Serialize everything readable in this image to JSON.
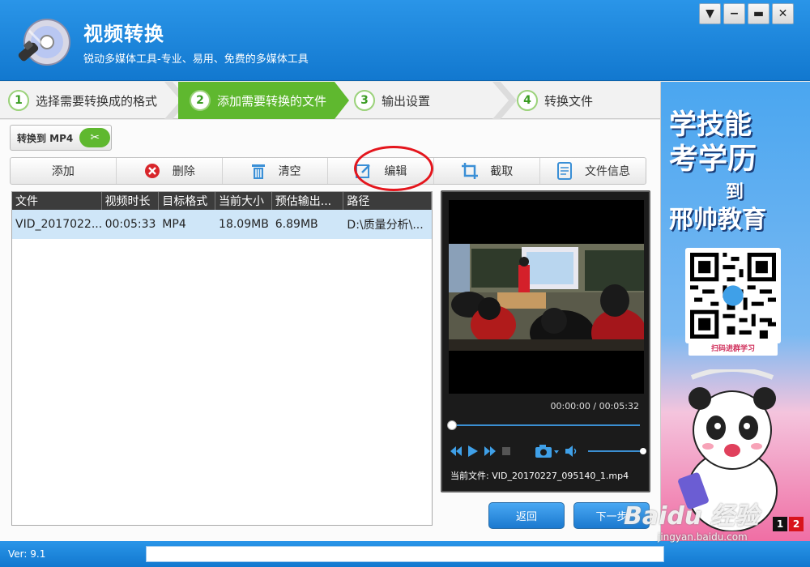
{
  "app": {
    "title": "视频转换",
    "subtitle": "锐动多媒体工具-专业、易用、免费的多媒体工具"
  },
  "window_buttons": [
    "▼",
    "−",
    "▬",
    "✕"
  ],
  "steps": [
    {
      "num": "1",
      "label": "选择需要转换成的格式",
      "active": false
    },
    {
      "num": "2",
      "label": "添加需要转换的文件",
      "active": true
    },
    {
      "num": "3",
      "label": "输出设置",
      "active": false
    },
    {
      "num": "4",
      "label": "转换文件",
      "active": false
    }
  ],
  "convert_to": "转换到 MP4",
  "toolbar": {
    "add": "添加",
    "delete": "删除",
    "clear": "清空",
    "edit": "编辑",
    "crop": "截取",
    "info": "文件信息"
  },
  "table": {
    "headers": [
      "文件",
      "视频时长",
      "目标格式",
      "当前大小",
      "预估输出...",
      "路径"
    ],
    "rows": [
      [
        "VID_2017022...",
        "00:05:33",
        "MP4",
        "18.09MB",
        "6.89MB",
        "D:\\质量分析\\..."
      ]
    ]
  },
  "preview": {
    "time": "00:00:00 / 00:05:32",
    "current_file": "当前文件: VID_20170227_095140_1.mp4",
    "seek_progress": 0.0,
    "volume_level": 1.0
  },
  "nav": {
    "back": "返回",
    "next": "下一步"
  },
  "ad": {
    "line1": "学技能",
    "line2": "考学历",
    "to": "到",
    "line3": "邢帅教育",
    "qr_caption": "扫码进群学习",
    "pages": [
      "1",
      "2"
    ]
  },
  "status": {
    "version": "Ver: 9.1"
  },
  "watermark": {
    "brand": "Baidu 经验",
    "url": "jingyan.baidu.com"
  },
  "colors": {
    "titlebar": "#1a84db",
    "step_active": "#5fb82f",
    "highlight_ring": "#e4161d",
    "row_selected": "#cfe6f8"
  }
}
